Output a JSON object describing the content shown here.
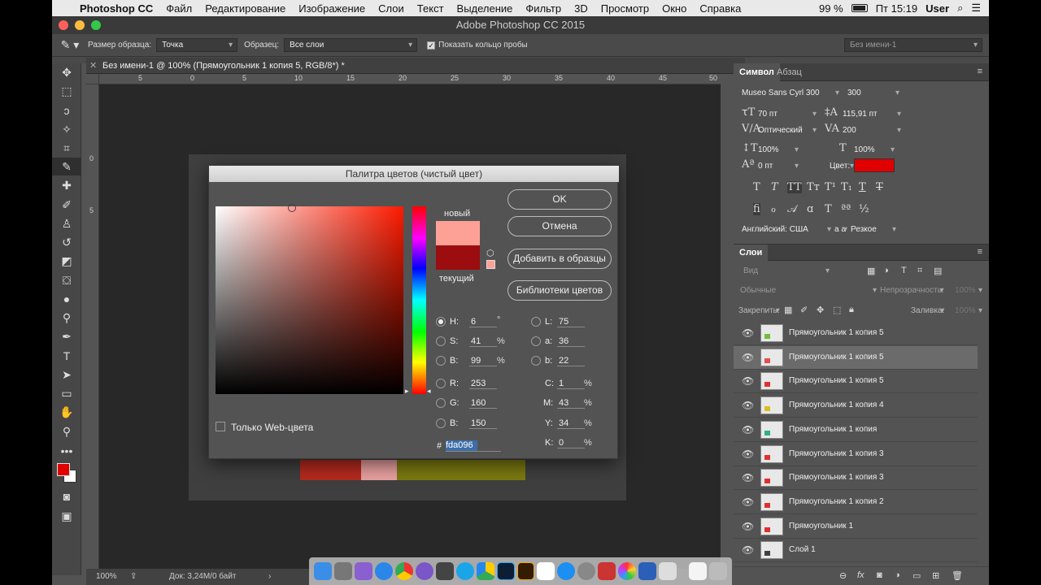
{
  "menubar": {
    "app_name": "Photoshop CC",
    "items": [
      "Файл",
      "Редактирование",
      "Изображение",
      "Слои",
      "Текст",
      "Выделение",
      "Фильтр",
      "3D",
      "Просмотр",
      "Окно",
      "Справка"
    ],
    "battery": "99 %",
    "clock": "Пт 15:19",
    "user": "User"
  },
  "window": {
    "title": "Adobe Photoshop CC 2015"
  },
  "options_bar": {
    "sample_size_label": "Размер образца:",
    "sample_size_value": "Точка",
    "sample_label": "Образец:",
    "sample_value": "Все слои",
    "show_ring_label": "Показать кольцо пробы",
    "workspace": "Без имени-1"
  },
  "document": {
    "tab_title": "Без имени-1 @ 100% (Прямоугольник 1 копия 5, RGB/8*) *",
    "ruler_h": [
      "5",
      "0",
      "5",
      "10",
      "15",
      "20",
      "25",
      "30",
      "35",
      "40",
      "45",
      "50"
    ],
    "ruler_v": [
      "0",
      "5"
    ]
  },
  "status": {
    "zoom": "100%",
    "doc_info": "Док: 3,24М/0 байт"
  },
  "color_picker": {
    "title": "Палитра цветов (чистый цвет)",
    "new_label": "новый",
    "current_label": "текущий",
    "new_color": "#fda096",
    "current_color": "#9b0d0f",
    "buttons": {
      "ok": "OK",
      "cancel": "Отмена",
      "add_swatches": "Добавить в образцы",
      "libraries": "Библиотеки цветов"
    },
    "web_only_label": "Только Web-цвета",
    "fields": {
      "H": {
        "label": "H:",
        "value": "6",
        "unit": "°"
      },
      "S": {
        "label": "S:",
        "value": "41",
        "unit": "%"
      },
      "Bv": {
        "label": "B:",
        "value": "99",
        "unit": "%"
      },
      "R": {
        "label": "R:",
        "value": "253"
      },
      "G": {
        "label": "G:",
        "value": "160"
      },
      "Bb": {
        "label": "B:",
        "value": "150"
      },
      "L": {
        "label": "L:",
        "value": "75"
      },
      "a": {
        "label": "a:",
        "value": "36"
      },
      "b": {
        "label": "b:",
        "value": "22"
      },
      "C": {
        "label": "C:",
        "value": "1",
        "unit": "%"
      },
      "M": {
        "label": "M:",
        "value": "43",
        "unit": "%"
      },
      "Y": {
        "label": "Y:",
        "value": "34",
        "unit": "%"
      },
      "K": {
        "label": "K:",
        "value": "0",
        "unit": "%"
      }
    },
    "hex_label": "#",
    "hex_value": "fda096"
  },
  "character_panel": {
    "tabs": [
      "Символ",
      "Абзац"
    ],
    "font_family": "Museo Sans Cyrl 300",
    "font_style": "300",
    "size": "70 пт",
    "leading": "115,91 пт",
    "kerning": "Оптический",
    "tracking": "200",
    "vscale": "100%",
    "hscale": "100%",
    "baseline": "0 пт",
    "color_label": "Цвет:",
    "color": "#e00000",
    "language": "Английский: США",
    "aa_label": "a a",
    "antialias": "Резкое"
  },
  "layers_panel": {
    "title": "Слои",
    "search_placeholder": "Вид",
    "blend_mode": "Обычные",
    "opacity_label": "Непрозрачность:",
    "opacity_value": "100%",
    "lock_label": "Закрепить:",
    "fill_label": "Заливка:",
    "fill_value": "100%",
    "layers": [
      {
        "name": "Прямоугольник 1 копия 5",
        "selected": false,
        "mark": "#6fbf3a"
      },
      {
        "name": "Прямоугольник 1 копия 5",
        "selected": true,
        "mark": "#e05050"
      },
      {
        "name": "Прямоугольник 1 копия 5",
        "selected": false,
        "mark": "#e03030"
      },
      {
        "name": "Прямоугольник 1 копия 4",
        "selected": false,
        "mark": "#d8c020"
      },
      {
        "name": "Прямоугольник 1 копия",
        "selected": false,
        "mark": "#30b080"
      },
      {
        "name": "Прямоугольник 1 копия 3",
        "selected": false,
        "mark": "#e03030"
      },
      {
        "name": "Прямоугольник 1 копия 3",
        "selected": false,
        "mark": "#e03030"
      },
      {
        "name": "Прямоугольник 1 копия 2",
        "selected": false,
        "mark": "#e03030"
      },
      {
        "name": "Прямоугольник 1",
        "selected": false,
        "mark": "#e03030"
      },
      {
        "name": "Слой 1",
        "selected": false,
        "mark": "#404040"
      }
    ]
  },
  "canvas_swatches": [
    "#b52a1e",
    "#e8a0a0",
    "#7c7a10"
  ],
  "toolbar_colors": {
    "foreground": "#e00000",
    "background": "#ffffff"
  }
}
